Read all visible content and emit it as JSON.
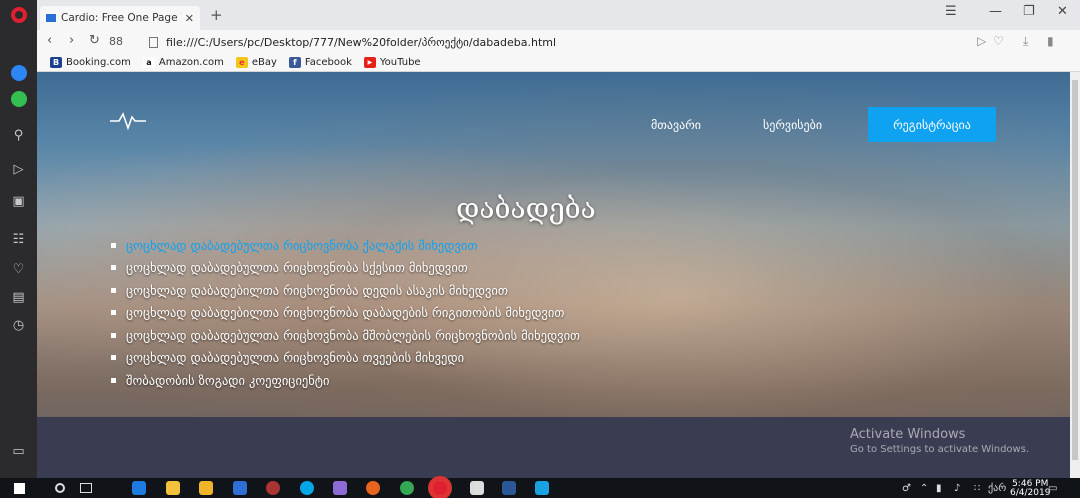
{
  "browser": {
    "tab_title": "Cardio: Free One Page Ten",
    "tab_close": "✕",
    "new_tab": "+",
    "url": "file:///C:/Users/pc/Desktop/777/New%20folder/პროექტი/dabadeba.html",
    "speed_dial": "88",
    "bookmarks": [
      {
        "label": "Booking.com",
        "icon": "B",
        "color": "#1d3f8f"
      },
      {
        "label": "Amazon.com",
        "icon": "a",
        "color": "#ff9a00"
      },
      {
        "label": "eBay",
        "icon": "e",
        "color": "#e53238"
      },
      {
        "label": "Facebook",
        "icon": "f",
        "color": "#3b5998"
      },
      {
        "label": "YouTube",
        "icon": "▶",
        "color": "#e62117"
      }
    ]
  },
  "page": {
    "nav": {
      "home": "მთავარი",
      "services": "სერვისები",
      "register": "რეგისტრაცია"
    },
    "heading": "დაბადება",
    "list": [
      "ცოცხლად დაბადებულთა რიცხოვნობა ქალაქის მიხედვით",
      "ცოცხლად დაბადებულთა რიცხოვნობა სქესით მიხედვით",
      "ცოცხლად დაბადებილთა რიცხოვნობა დედის ასაკის მიხედვით",
      "ცოცხლად დაბადებილთა რიცხოვნობა დაბადების რიგითობის მიხედვით",
      "ცოცხლად დაბადებულთა რიცხოვნობა მშობლების რიცხოვნობის მიხედვით",
      "ცოცხლად დაბადებულთა რიცხოვნობა თვეების მიხვედი",
      "შობადობის ზოგადი კოეფიციენტი"
    ],
    "accent": "#0ea2f0"
  },
  "watermark": {
    "line1": "Activate Windows",
    "line2": "Go to Settings to activate Windows."
  },
  "taskbar": {
    "time": "5:46 PM",
    "date": "6/4/2019",
    "lang": "ქარ"
  }
}
